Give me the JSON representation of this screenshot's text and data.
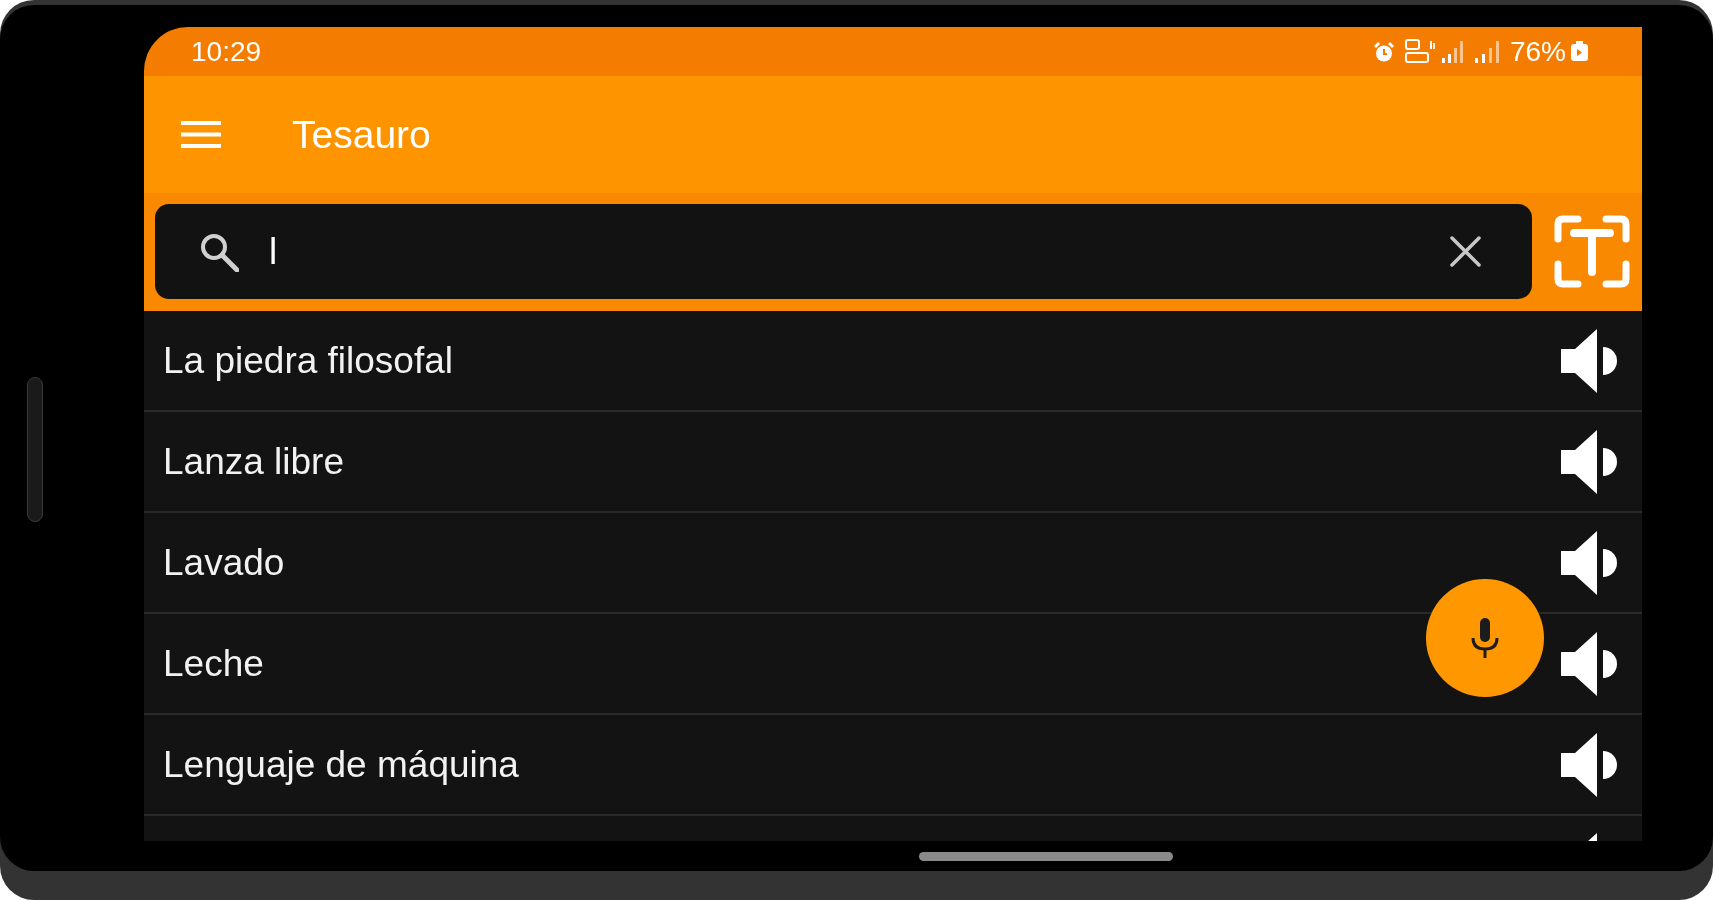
{
  "status_bar": {
    "time": "10:29",
    "battery": "76%"
  },
  "app_bar": {
    "title": "Tesauro"
  },
  "search": {
    "value": "l"
  },
  "results": [
    "La piedra filosofal",
    "Lanza libre",
    "Lavado",
    "Leche",
    "Lenguaje de máquina"
  ]
}
